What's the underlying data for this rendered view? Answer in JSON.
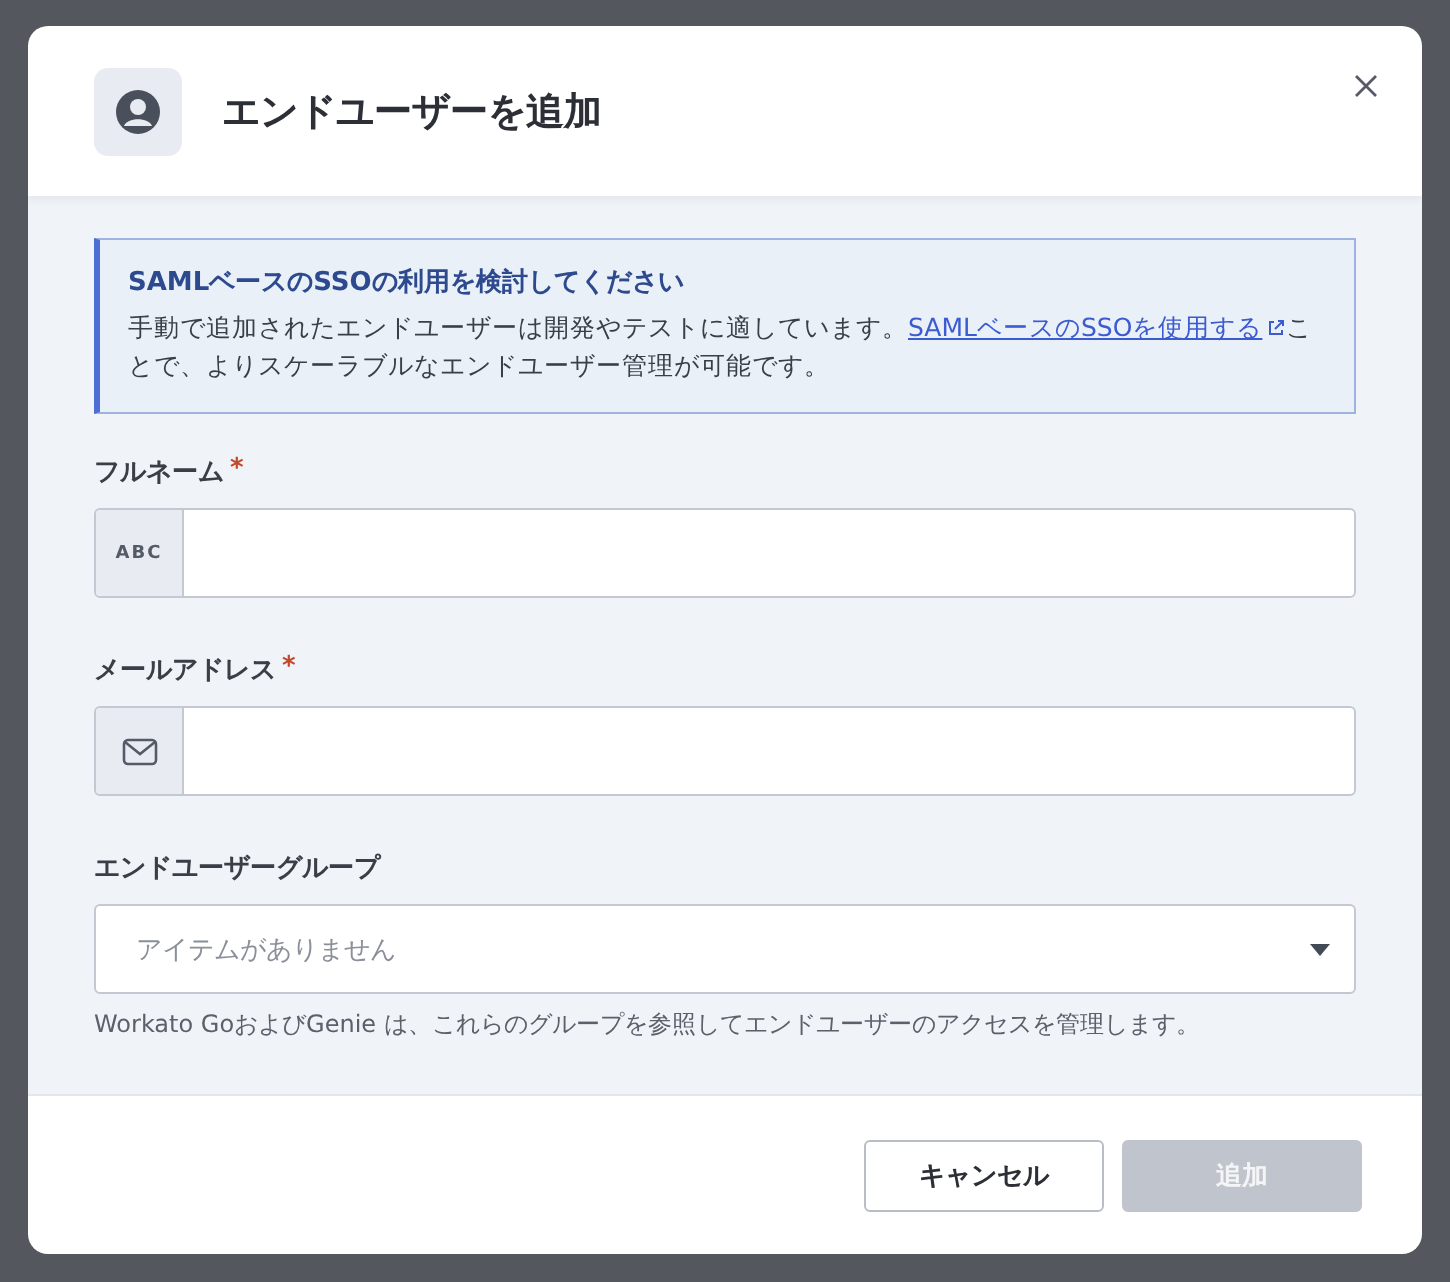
{
  "dialog": {
    "title": "エンドユーザーを追加"
  },
  "notice": {
    "title": "SAMLベースのSSOの利用を検討してください",
    "text_before": "手動で追加されたエンドユーザーは開発やテストに適しています。",
    "link": "SAMLベースのSSOを使用する",
    "text_after": "ことで、よりスケーラブルなエンドユーザー管理が可能です。"
  },
  "fields": [
    {
      "kind": "text",
      "label": "フルネーム",
      "required_mark": "*",
      "addon": "ABC"
    },
    {
      "kind": "email",
      "label": "メールアドレス",
      "required_mark": "*"
    },
    {
      "kind": "select",
      "label": "エンドユーザーグループ",
      "placeholder": "アイテムがありません",
      "help": "Workato GoおよびGenie は、これらのグループを参照してエンドユーザーのアクセスを管理します。"
    }
  ],
  "buttons": [
    {
      "label": "キャンセル",
      "kind": "secondary",
      "disabled": false
    },
    {
      "label": "追加",
      "kind": "primary",
      "disabled": true
    }
  ]
}
